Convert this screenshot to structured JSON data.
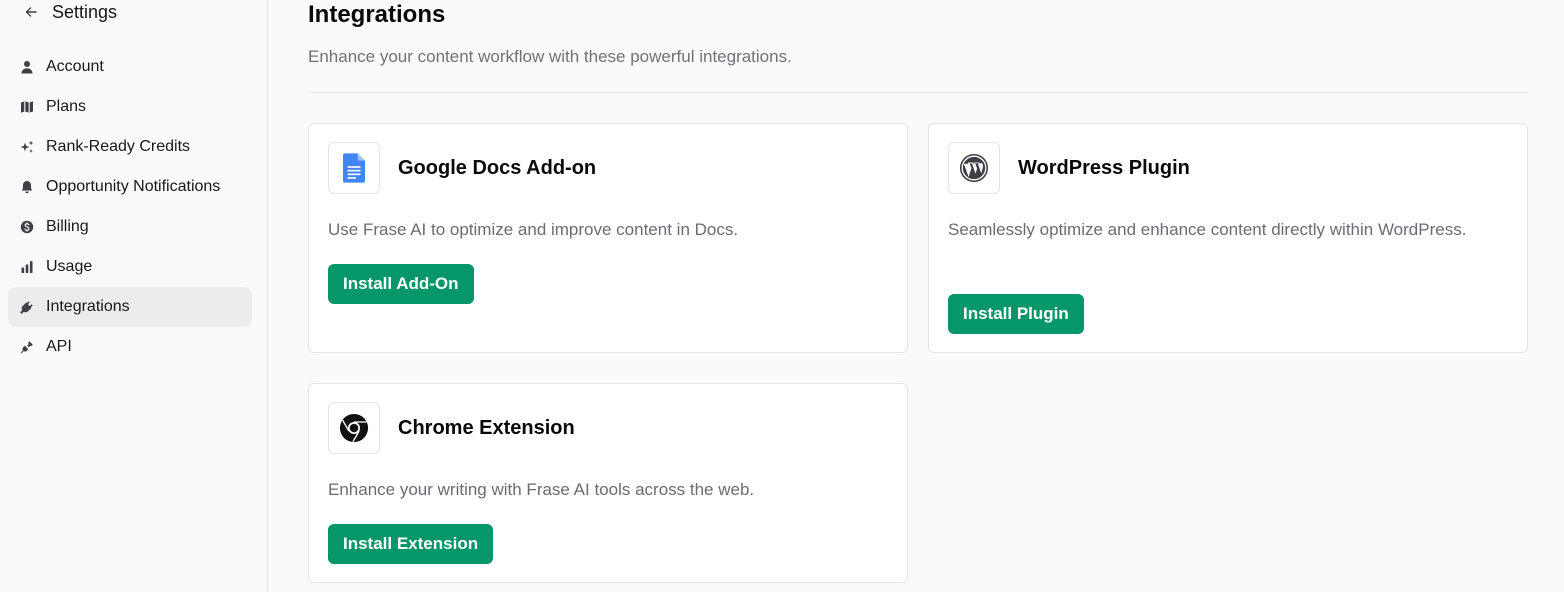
{
  "sidebar": {
    "header": {
      "back_icon": "arrow-left-icon",
      "title": "Settings"
    },
    "items": [
      {
        "label": "Account",
        "icon": "user-icon",
        "active": false
      },
      {
        "label": "Plans",
        "icon": "map-icon",
        "active": false
      },
      {
        "label": "Rank-Ready Credits",
        "icon": "sparkles-icon",
        "active": false
      },
      {
        "label": "Opportunity Notifications",
        "icon": "bell-icon",
        "active": false
      },
      {
        "label": "Billing",
        "icon": "dollar-circle-icon",
        "active": false
      },
      {
        "label": "Usage",
        "icon": "bar-chart-icon",
        "active": false
      },
      {
        "label": "Integrations",
        "icon": "plug-icon",
        "active": true
      },
      {
        "label": "API",
        "icon": "plug-connect-icon",
        "active": false
      }
    ]
  },
  "main": {
    "title": "Integrations",
    "subtitle": "Enhance your content workflow with these powerful integrations.",
    "cards": [
      {
        "title": "Google Docs Add-on",
        "icon": "google-docs-icon",
        "description": "Use Frase AI to optimize and improve content in Docs.",
        "button": "Install Add-On"
      },
      {
        "title": "WordPress Plugin",
        "icon": "wordpress-icon",
        "description": "Seamlessly optimize and enhance content directly within WordPress.",
        "button": "Install Plugin"
      },
      {
        "title": "Chrome Extension",
        "icon": "chrome-icon",
        "description": "Enhance your writing with Frase AI tools across the web.",
        "button": "Install Extension"
      }
    ]
  },
  "colors": {
    "accent": "#059669",
    "active_nav_bg": "#ececec",
    "muted_text": "#71717a",
    "google_docs_blue": "#4285F4"
  }
}
